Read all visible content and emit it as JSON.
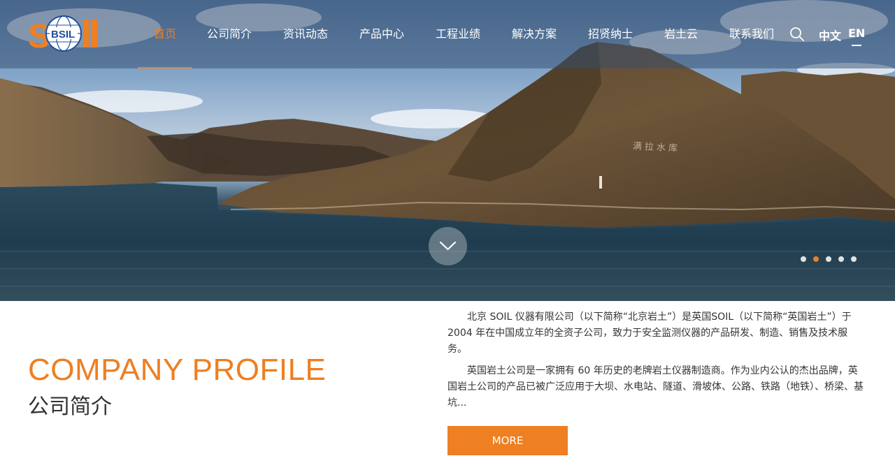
{
  "brand": {
    "logo_text": "BSIL",
    "logo_word": "SOIL",
    "accent_color": "#ee7f22",
    "logo_blue": "#1f4f9c"
  },
  "nav": {
    "items": [
      {
        "label": "首页",
        "active": true
      },
      {
        "label": "公司简介"
      },
      {
        "label": "资讯动态"
      },
      {
        "label": "产品中心"
      },
      {
        "label": "工程业绩"
      },
      {
        "label": "解决方案"
      },
      {
        "label": "招贤纳士"
      },
      {
        "label": "岩土云"
      },
      {
        "label": "联系我们"
      }
    ],
    "search_icon": "search-icon",
    "lang_cn": "中文",
    "lang_en": "EN"
  },
  "hero": {
    "signage_text": "满拉水库",
    "slides_total": 5,
    "active_slide": 2,
    "scroll_icon": "chevron-down-icon"
  },
  "profile": {
    "title_en": "COMPANY PROFILE",
    "title_cn": "公司简介",
    "paragraph_1": "北京 SOIL 仪器有限公司（以下简称“北京岩土”）是英国SOIL（以下简称“英国岩土”）于 2004 年在中国成立年的全资子公司，致力于安全监测仪器的产品研发、制造、销售及技术服务。",
    "paragraph_2": "英国岩土公司是一家拥有 60 年历史的老牌岩土仪器制造商。作为业内公认的杰出品牌，英国岩土公司的产品已被广泛应用于大坝、水电站、隧道、滑坡体、公路、铁路（地铁）、桥梁、基坑...",
    "more_label": "MORE"
  }
}
